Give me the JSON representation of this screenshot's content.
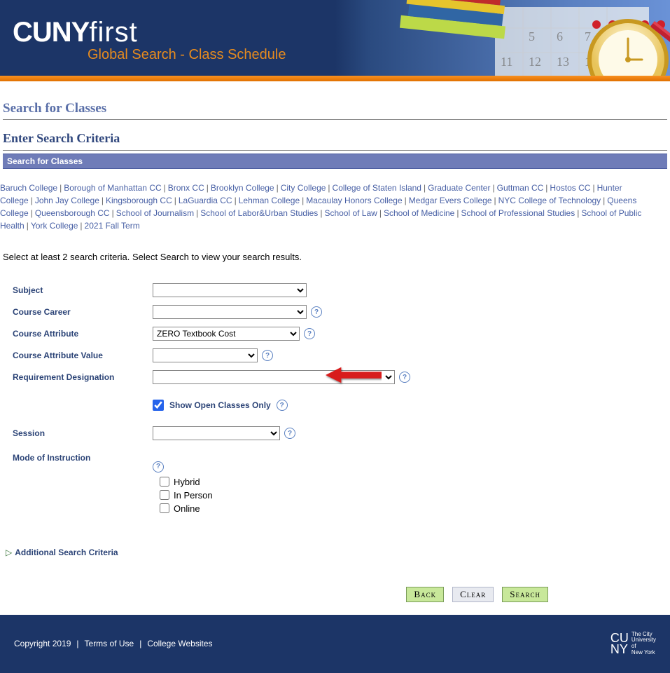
{
  "header": {
    "logo_cuny": "CUNY",
    "logo_first": "first",
    "tagline": "Global Search - Class Schedule"
  },
  "titles": {
    "page_title": "Search for Classes",
    "page_subtitle": "Enter Search Criteria",
    "section_bar": "Search for Classes"
  },
  "colleges_list": [
    "Baruch College",
    "Borough of Manhattan CC",
    "Bronx CC",
    "Brooklyn College",
    "City College",
    "College of Staten Island",
    "Graduate Center",
    "Guttman CC",
    "Hostos CC",
    "Hunter College",
    "John Jay College",
    "Kingsborough CC",
    "LaGuardia CC",
    "Lehman College",
    "Macaulay Honors College",
    "Medgar Evers College",
    "NYC College of Technology",
    "Queens College",
    "Queensborough CC",
    "School of Journalism",
    "School of Labor&Urban Studies",
    "School of Law",
    "School of Medicine",
    "School of Professional Studies",
    "School of Public Health",
    "York College",
    "2021 Fall Term"
  ],
  "instructions": "Select at least 2 search criteria. Select Search to view your search results.",
  "form": {
    "subject": {
      "label": "Subject",
      "value": ""
    },
    "career": {
      "label": "Course Career",
      "value": ""
    },
    "attr": {
      "label": "Course Attribute",
      "value": "ZERO Textbook Cost"
    },
    "attrval": {
      "label": "Course Attribute Value",
      "value": ""
    },
    "reqdes": {
      "label": "Requirement Designation",
      "value": ""
    },
    "show_open": {
      "label": "Show Open Classes Only",
      "checked": true
    },
    "session": {
      "label": "Session",
      "value": ""
    },
    "mode": {
      "label": "Mode of Instruction",
      "options": [
        {
          "label": "Hybrid",
          "checked": false
        },
        {
          "label": "In Person",
          "checked": false
        },
        {
          "label": "Online",
          "checked": false
        }
      ]
    }
  },
  "additional_link": "Additional Search Criteria",
  "buttons": {
    "back": "Back",
    "clear": "Clear",
    "search": "Search"
  },
  "footer": {
    "copyright": "Copyright 2019",
    "terms": "Terms of Use",
    "sites": "College Websites",
    "logo_text": "CU NY",
    "logo_tag": "The City\nUniversity\nof\nNew York"
  }
}
